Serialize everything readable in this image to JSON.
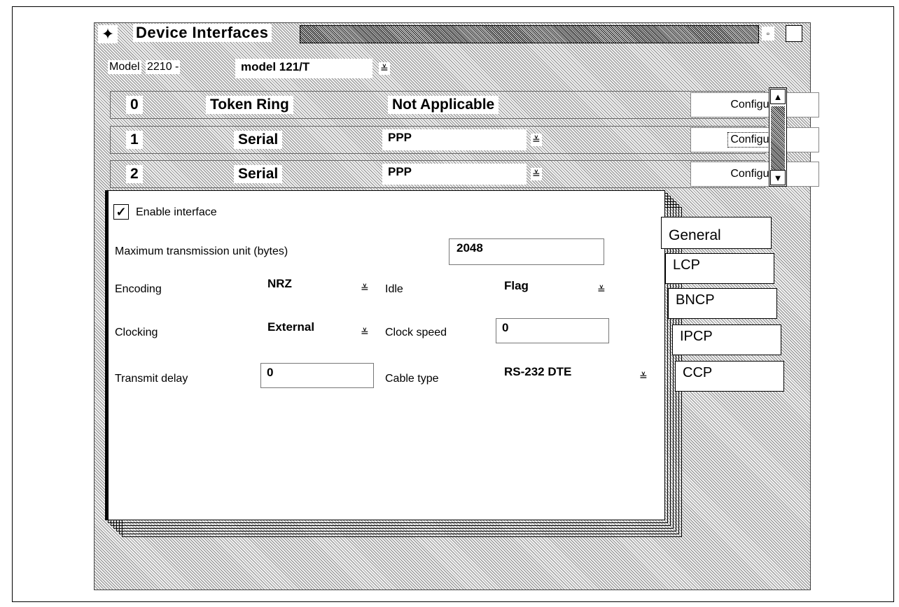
{
  "window": {
    "title": "Device Interfaces",
    "minimize_glyph": "▫",
    "sysmenu_glyph": "✦"
  },
  "model": {
    "label": "Model",
    "prefix": "2210 -",
    "value": "model 121/T"
  },
  "interfaces": [
    {
      "number": "0",
      "type": "Token Ring",
      "protocol": "Not Applicable",
      "configure": "Configure"
    },
    {
      "number": "1",
      "type": "Serial",
      "protocol": "PPP",
      "configure": "Configure"
    },
    {
      "number": "2",
      "type": "Serial",
      "protocol": "PPP",
      "configure": "Configure"
    }
  ],
  "general": {
    "enable_label": "Enable interface",
    "enable_checked": "✓",
    "mtu_label": "Maximum transmission unit (bytes)",
    "mtu_value": "2048",
    "encoding_label": "Encoding",
    "encoding_value": "NRZ",
    "idle_label": "Idle",
    "idle_value": "Flag",
    "clocking_label": "Clocking",
    "clocking_value": "External",
    "clock_speed_label": "Clock speed",
    "clock_speed_value": "0",
    "transmit_delay_label": "Transmit delay",
    "transmit_delay_value": "0",
    "cable_type_label": "Cable type",
    "cable_type_value": "RS-232 DTE"
  },
  "tabs": [
    "General",
    "LCP",
    "BNCP",
    "IPCP",
    "CCP"
  ],
  "icons": {
    "dropdown": "≚",
    "scroll_up": "▲",
    "scroll_down": "▼"
  }
}
